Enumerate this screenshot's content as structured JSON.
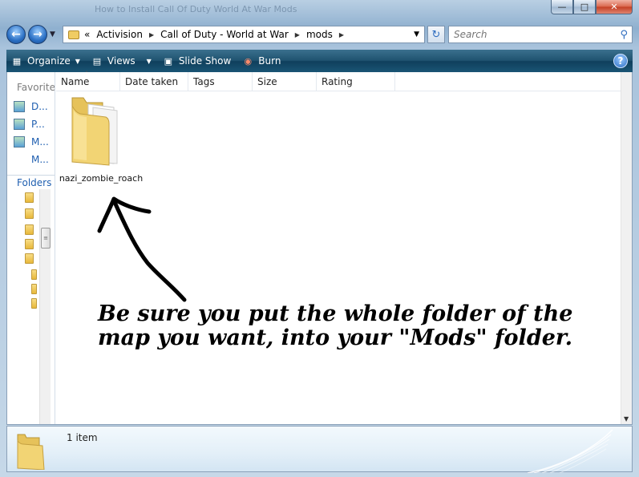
{
  "window": {
    "background_title": "How to Install Call Of Duty World At War Mods"
  },
  "address_bar": {
    "overflow": "«",
    "crumbs": [
      "Activision",
      "Call of Duty - World at War",
      "mods"
    ]
  },
  "search": {
    "placeholder": "Search"
  },
  "toolbar": {
    "organize": "Organize",
    "views": "Views",
    "slideshow": "Slide Show",
    "burn": "Burn",
    "help": "?"
  },
  "nav_pane": {
    "favorites_header": "Favorite l",
    "favorites": [
      "D...",
      "P...",
      "M...",
      "M..."
    ],
    "folders_header": "Folders"
  },
  "columns": [
    "Name",
    "Date taken",
    "Tags",
    "Size",
    "Rating"
  ],
  "files": [
    {
      "name": "nazi_zombie_roach",
      "type": "folder"
    }
  ],
  "annotation": {
    "line1": "Be sure you put the whole folder of  the",
    "line2": "map you want, into your \"Mods\" folder."
  },
  "details": {
    "count": "1 item"
  },
  "colors": {
    "toolbar": "#1f5370",
    "link": "#1f5fb0",
    "folder": "#f0cc63"
  }
}
